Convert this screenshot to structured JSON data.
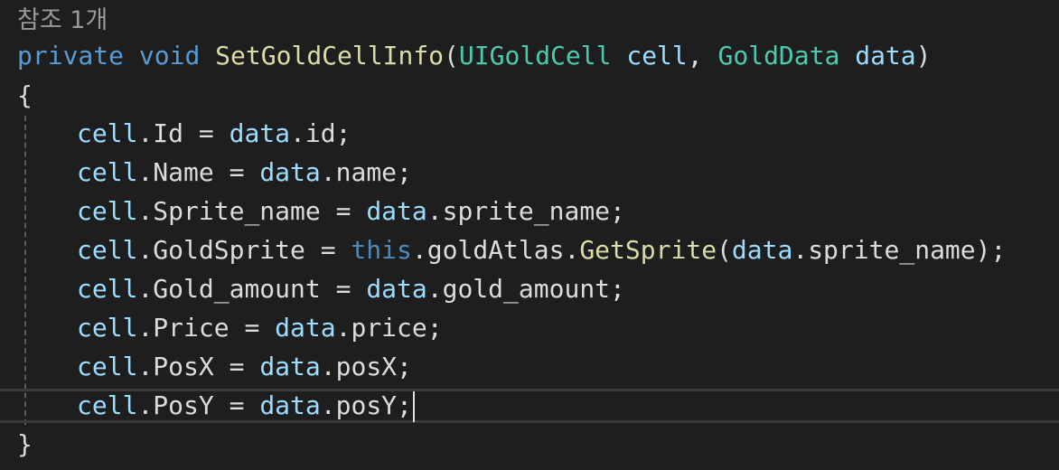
{
  "codelens": "참조 1개",
  "signature": {
    "modifier": "private",
    "return_type": "void",
    "method_name": "SetGoldCellInfo",
    "open_paren": "(",
    "param1_type": "UIGoldCell",
    "param1_name": "cell",
    "comma": ",",
    "param2_type": "GoldData",
    "param2_name": "data",
    "close_paren": ")"
  },
  "open_brace": "{",
  "close_brace": "}",
  "statements": [
    {
      "lhs": "cell",
      "lhs_prop": "Id",
      "op": " = ",
      "rhs": "data",
      "rhs_prop": "id",
      "end": ";"
    },
    {
      "lhs": "cell",
      "lhs_prop": "Name",
      "op": " = ",
      "rhs": "data",
      "rhs_prop": "name",
      "end": ";"
    },
    {
      "lhs": "cell",
      "lhs_prop": "Sprite_name",
      "op": " = ",
      "rhs": "data",
      "rhs_prop": "sprite_name",
      "end": ";"
    },
    {
      "lhs": "cell",
      "lhs_prop": "GoldSprite",
      "op": " = ",
      "this_kw": "this",
      "field": "goldAtlas",
      "call": "GetSprite",
      "arg_obj": "data",
      "arg_prop": "sprite_name",
      "end": ");"
    },
    {
      "lhs": "cell",
      "lhs_prop": "Gold_amount",
      "op": " = ",
      "rhs": "data",
      "rhs_prop": "gold_amount",
      "end": ";"
    },
    {
      "lhs": "cell",
      "lhs_prop": "Price",
      "op": " = ",
      "rhs": "data",
      "rhs_prop": "price",
      "end": ";"
    },
    {
      "lhs": "cell",
      "lhs_prop": "PosX",
      "op": " = ",
      "rhs": "data",
      "rhs_prop": "posX",
      "end": ";"
    },
    {
      "lhs": "cell",
      "lhs_prop": "PosY",
      "op": " = ",
      "rhs": "data",
      "rhs_prop": "posY",
      "end": ";"
    }
  ],
  "dot": ".",
  "colors": {
    "background": "#1e1e1e",
    "keyword": "#569cd6",
    "type": "#4ec9b0",
    "method": "#dcdcaa",
    "parameter": "#9cdcfe",
    "text": "#dcdcdc"
  }
}
